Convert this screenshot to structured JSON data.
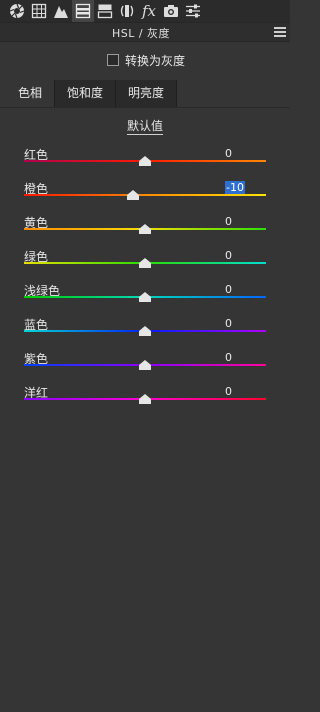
{
  "toolbar": {
    "icons": [
      "aperture-icon",
      "grid-histogram-icon",
      "mountain-icon",
      "hsl-panel-icon",
      "split-tone-icon",
      "lens-icon",
      "fx-icon",
      "camera-icon",
      "sliders-icon"
    ],
    "fx_label": "fx"
  },
  "panel": {
    "title": "HSL / 灰度",
    "grayscale_label": "转换为灰度"
  },
  "tabs": [
    "色相",
    "饱和度",
    "明亮度"
  ],
  "active_tab": "色相",
  "default_label": "默认值",
  "sliders": [
    {
      "label": "红色",
      "value": "0",
      "colors": [
        "#b0004f",
        "#ff1a00",
        "#ff8800"
      ]
    },
    {
      "label": "橙色",
      "value": "-10",
      "selected": true,
      "colors": [
        "#ff1500",
        "#ff8a00",
        "#ffe400"
      ]
    },
    {
      "label": "黄色",
      "value": "0",
      "colors": [
        "#ff8a00",
        "#f2e000",
        "#2ee000"
      ]
    },
    {
      "label": "绿色",
      "value": "0",
      "colors": [
        "#e6e000",
        "#2adc00",
        "#00ddd0"
      ]
    },
    {
      "label": "浅绿色",
      "value": "0",
      "colors": [
        "#00d000",
        "#00d8b8",
        "#0066ff"
      ]
    },
    {
      "label": "蓝色",
      "value": "0",
      "colors": [
        "#00d8d0",
        "#0020ff",
        "#b000ff"
      ]
    },
    {
      "label": "紫色",
      "value": "0",
      "colors": [
        "#0040ff",
        "#8a00ff",
        "#ff00a0"
      ]
    },
    {
      "label": "洋红",
      "value": "0",
      "colors": [
        "#8a00ff",
        "#ff00d0",
        "#ff0030"
      ]
    }
  ]
}
